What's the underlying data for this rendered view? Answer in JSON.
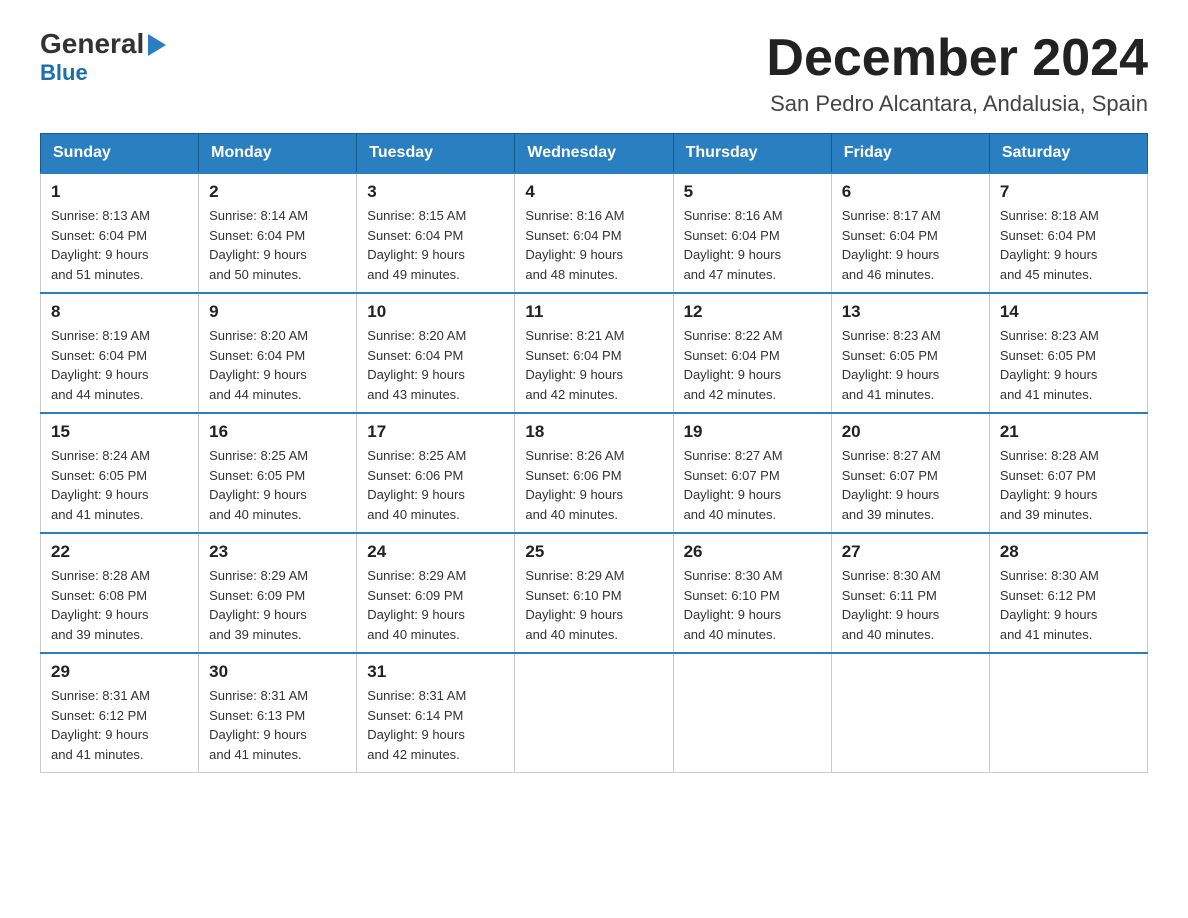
{
  "logo": {
    "general": "General",
    "blue": "Blue",
    "triangle": "▶"
  },
  "header": {
    "title": "December 2024",
    "subtitle": "San Pedro Alcantara, Andalusia, Spain"
  },
  "weekdays": [
    "Sunday",
    "Monday",
    "Tuesday",
    "Wednesday",
    "Thursday",
    "Friday",
    "Saturday"
  ],
  "weeks": [
    [
      {
        "day": "1",
        "sunrise": "8:13 AM",
        "sunset": "6:04 PM",
        "daylight": "9 hours and 51 minutes."
      },
      {
        "day": "2",
        "sunrise": "8:14 AM",
        "sunset": "6:04 PM",
        "daylight": "9 hours and 50 minutes."
      },
      {
        "day": "3",
        "sunrise": "8:15 AM",
        "sunset": "6:04 PM",
        "daylight": "9 hours and 49 minutes."
      },
      {
        "day": "4",
        "sunrise": "8:16 AM",
        "sunset": "6:04 PM",
        "daylight": "9 hours and 48 minutes."
      },
      {
        "day": "5",
        "sunrise": "8:16 AM",
        "sunset": "6:04 PM",
        "daylight": "9 hours and 47 minutes."
      },
      {
        "day": "6",
        "sunrise": "8:17 AM",
        "sunset": "6:04 PM",
        "daylight": "9 hours and 46 minutes."
      },
      {
        "day": "7",
        "sunrise": "8:18 AM",
        "sunset": "6:04 PM",
        "daylight": "9 hours and 45 minutes."
      }
    ],
    [
      {
        "day": "8",
        "sunrise": "8:19 AM",
        "sunset": "6:04 PM",
        "daylight": "9 hours and 44 minutes."
      },
      {
        "day": "9",
        "sunrise": "8:20 AM",
        "sunset": "6:04 PM",
        "daylight": "9 hours and 44 minutes."
      },
      {
        "day": "10",
        "sunrise": "8:20 AM",
        "sunset": "6:04 PM",
        "daylight": "9 hours and 43 minutes."
      },
      {
        "day": "11",
        "sunrise": "8:21 AM",
        "sunset": "6:04 PM",
        "daylight": "9 hours and 42 minutes."
      },
      {
        "day": "12",
        "sunrise": "8:22 AM",
        "sunset": "6:04 PM",
        "daylight": "9 hours and 42 minutes."
      },
      {
        "day": "13",
        "sunrise": "8:23 AM",
        "sunset": "6:05 PM",
        "daylight": "9 hours and 41 minutes."
      },
      {
        "day": "14",
        "sunrise": "8:23 AM",
        "sunset": "6:05 PM",
        "daylight": "9 hours and 41 minutes."
      }
    ],
    [
      {
        "day": "15",
        "sunrise": "8:24 AM",
        "sunset": "6:05 PM",
        "daylight": "9 hours and 41 minutes."
      },
      {
        "day": "16",
        "sunrise": "8:25 AM",
        "sunset": "6:05 PM",
        "daylight": "9 hours and 40 minutes."
      },
      {
        "day": "17",
        "sunrise": "8:25 AM",
        "sunset": "6:06 PM",
        "daylight": "9 hours and 40 minutes."
      },
      {
        "day": "18",
        "sunrise": "8:26 AM",
        "sunset": "6:06 PM",
        "daylight": "9 hours and 40 minutes."
      },
      {
        "day": "19",
        "sunrise": "8:27 AM",
        "sunset": "6:07 PM",
        "daylight": "9 hours and 40 minutes."
      },
      {
        "day": "20",
        "sunrise": "8:27 AM",
        "sunset": "6:07 PM",
        "daylight": "9 hours and 39 minutes."
      },
      {
        "day": "21",
        "sunrise": "8:28 AM",
        "sunset": "6:07 PM",
        "daylight": "9 hours and 39 minutes."
      }
    ],
    [
      {
        "day": "22",
        "sunrise": "8:28 AM",
        "sunset": "6:08 PM",
        "daylight": "9 hours and 39 minutes."
      },
      {
        "day": "23",
        "sunrise": "8:29 AM",
        "sunset": "6:09 PM",
        "daylight": "9 hours and 39 minutes."
      },
      {
        "day": "24",
        "sunrise": "8:29 AM",
        "sunset": "6:09 PM",
        "daylight": "9 hours and 40 minutes."
      },
      {
        "day": "25",
        "sunrise": "8:29 AM",
        "sunset": "6:10 PM",
        "daylight": "9 hours and 40 minutes."
      },
      {
        "day": "26",
        "sunrise": "8:30 AM",
        "sunset": "6:10 PM",
        "daylight": "9 hours and 40 minutes."
      },
      {
        "day": "27",
        "sunrise": "8:30 AM",
        "sunset": "6:11 PM",
        "daylight": "9 hours and 40 minutes."
      },
      {
        "day": "28",
        "sunrise": "8:30 AM",
        "sunset": "6:12 PM",
        "daylight": "9 hours and 41 minutes."
      }
    ],
    [
      {
        "day": "29",
        "sunrise": "8:31 AM",
        "sunset": "6:12 PM",
        "daylight": "9 hours and 41 minutes."
      },
      {
        "day": "30",
        "sunrise": "8:31 AM",
        "sunset": "6:13 PM",
        "daylight": "9 hours and 41 minutes."
      },
      {
        "day": "31",
        "sunrise": "8:31 AM",
        "sunset": "6:14 PM",
        "daylight": "9 hours and 42 minutes."
      },
      null,
      null,
      null,
      null
    ]
  ],
  "labels": {
    "sunrise": "Sunrise:",
    "sunset": "Sunset:",
    "daylight": "Daylight:"
  }
}
